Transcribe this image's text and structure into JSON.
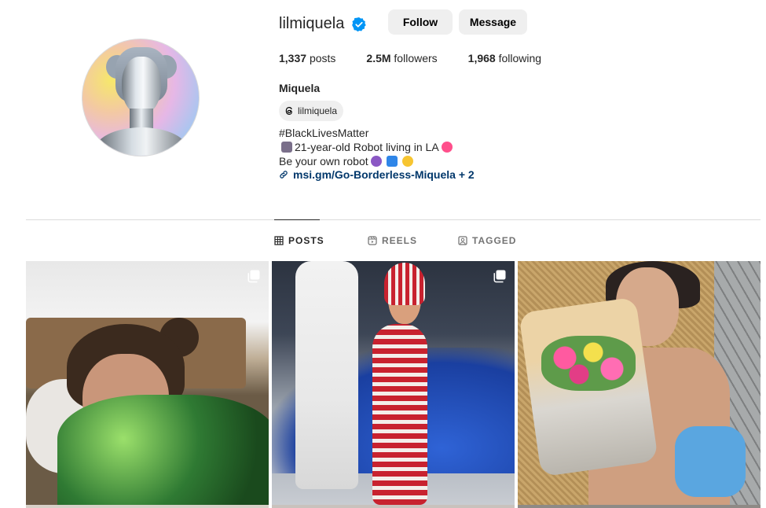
{
  "profile": {
    "username": "lilmiquela",
    "verified": true,
    "follow_label": "Follow",
    "message_label": "Message",
    "stats": {
      "posts_count": "1,337",
      "posts_label": "posts",
      "followers_count": "2.5M",
      "followers_label": "followers",
      "following_count": "1,968",
      "following_label": "following"
    },
    "full_name": "Miquela",
    "threads_handle": "lilmiquela",
    "bio": {
      "line1": "#BlackLivesMatter",
      "line2": "21-year-old Robot living in LA",
      "line3": "Be your own robot",
      "link": "msi.gm/Go-Borderless-Miquela + 2"
    }
  },
  "tabs": {
    "posts": "POSTS",
    "reels": "REELS",
    "tagged": "TAGGED",
    "active": "posts"
  },
  "colors": {
    "accent_blue": "#0095f6",
    "link_color": "#00376b",
    "button_bg": "#efefef",
    "divider": "#dbdbdb"
  },
  "icons": {
    "verified": "verified-badge-icon",
    "threads": "threads-icon",
    "link": "link-icon",
    "posts_tab": "grid-icon",
    "reels_tab": "reels-icon",
    "tagged_tab": "tagged-icon",
    "multi_post": "carousel-icon"
  }
}
